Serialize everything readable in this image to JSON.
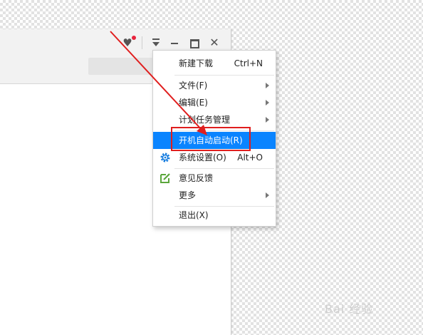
{
  "menu": {
    "items": [
      {
        "label": "新建下载",
        "shortcut": "Ctrl+N",
        "submenu": false
      },
      {
        "label": "文件(F)",
        "shortcut": "",
        "submenu": true
      },
      {
        "label": "编辑(E)",
        "shortcut": "",
        "submenu": true
      },
      {
        "label": "计划任务管理",
        "shortcut": "",
        "submenu": true
      },
      {
        "label": "开机自动启动(R)",
        "shortcut": "",
        "submenu": false,
        "highlighted": true
      },
      {
        "label": "系统设置(O)",
        "shortcut": "Alt+O",
        "submenu": false,
        "icon": "gear-icon"
      },
      {
        "label": "意见反馈",
        "shortcut": "",
        "submenu": false,
        "icon": "feedback-icon"
      },
      {
        "label": "更多",
        "shortcut": "",
        "submenu": true
      },
      {
        "label": "退出(X)",
        "shortcut": "",
        "submenu": false
      }
    ]
  },
  "colors": {
    "highlight": "#0a84ff",
    "annotation_red": "#e01e1e",
    "gear": "#1a7fe0",
    "feedback": "#5aa63b"
  },
  "watermark": {
    "text": "Bai 经验"
  }
}
